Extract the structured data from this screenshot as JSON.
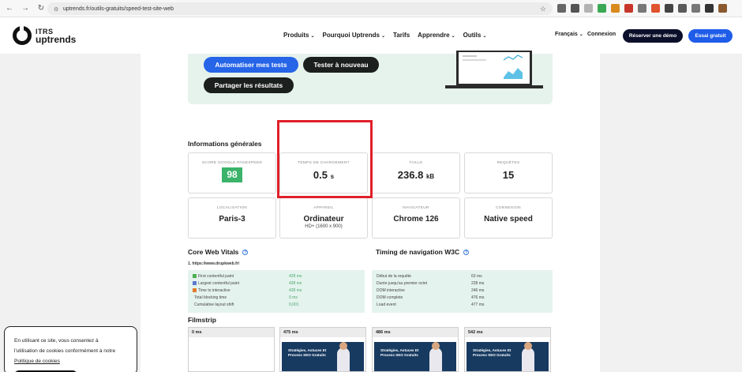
{
  "browser": {
    "url": "uptrends.fr/outils-gratuits/speed-test-site-web",
    "back_glyph": "←",
    "forward_glyph": "→",
    "reload_glyph": "↻",
    "lock_glyph": "⚙",
    "star_glyph": "☆",
    "extension_colors": [
      "#666666",
      "#555555",
      "#b3b3b3",
      "#3aa855",
      "#d98a1d",
      "#c8362b",
      "#777777",
      "#e0532f",
      "#444444",
      "#5a5a5a",
      "#777777",
      "#333333",
      "#8a5a2e"
    ]
  },
  "header": {
    "logo_line1": "ITRS",
    "logo_line2": "uptrends",
    "nav": [
      "Produits",
      "Pourquoi Uptrends",
      "Tarifs",
      "Apprendre",
      "Outils"
    ],
    "nav_has_chevron": [
      true,
      true,
      false,
      true,
      true
    ],
    "chevron_glyph": "⌄",
    "language": "Français",
    "login": "Connexion",
    "demo_button": "Réserver une démo",
    "trial_button": "Essai gratuit"
  },
  "hero": {
    "automate_button": "Automatiser mes tests",
    "retest_button": "Tester à nouveau",
    "share_button": "Partager les résultats"
  },
  "general_info": {
    "title": "Informations générales",
    "cards": [
      {
        "label": "SCORE GOOGLE PAGESPEED",
        "value": "98"
      },
      {
        "label": "TEMPS DE CHARGEMENT",
        "value": "0.5",
        "unit": "s"
      },
      {
        "label": "TAILLE",
        "value": "236.8",
        "unit": "kB"
      },
      {
        "label": "REQUÊTES",
        "value": "15"
      },
      {
        "label": "LOCALISATION",
        "value": "Paris-3"
      },
      {
        "label": "APPAREIL",
        "value": "Ordinateur",
        "sub": "HD+ (1600 x 900)"
      },
      {
        "label": "NAVIGATEUR",
        "value": "Chrome 126"
      },
      {
        "label": "CONNEXION",
        "value": "Native speed"
      }
    ]
  },
  "core_web_vitals": {
    "title": "Core Web Vitals",
    "help_glyph": "?",
    "site_url": "1. https://www.drupkweb.fr/",
    "rows": [
      {
        "name": "First contentful paint",
        "value": "428 ms",
        "color": "#4caf50"
      },
      {
        "name": "Largest contentful paint",
        "value": "428 ms",
        "color": "#5b7ad0"
      },
      {
        "name": "Time to interactive",
        "value": "428 ms",
        "color": "#e07b2c"
      },
      {
        "name": "Total blocking time",
        "value": "0 ms",
        "color": ""
      },
      {
        "name": "Cumulative layout shift",
        "value": "0,001",
        "color": ""
      }
    ]
  },
  "w3c_timing": {
    "title": "Timing de navigation W3C",
    "help_glyph": "?",
    "rows": [
      {
        "name": "Début de la requête",
        "value": "63 ms"
      },
      {
        "name": "Durée jusqu'au premier octet",
        "value": "228 ms"
      },
      {
        "name": "DOM interactive",
        "value": "246 ms"
      },
      {
        "name": "DOM complete",
        "value": "476 ms"
      },
      {
        "name": "Load event",
        "value": "477 ms"
      }
    ]
  },
  "filmstrip": {
    "title": "Filmstrip",
    "frames": [
      {
        "time": "0 ms",
        "caption": ""
      },
      {
        "time": "475 ms",
        "caption": "Stratégies, Astuces Et Process SEO Gratuits"
      },
      {
        "time": "486 ms",
        "caption": "Stratégies, Astuces Et Process SEO Gratuits"
      },
      {
        "time": "542 ms",
        "caption": "Stratégies, Astuces Et Process SEO Gratuits"
      }
    ]
  },
  "cookie_banner": {
    "line1": "En utilisant ce site, vous consentez à",
    "line2": "l'utilisation de cookies conformément à notre",
    "link": "Politique de cookies"
  },
  "colors": {
    "primary_blue": "#2664e8",
    "dark_navy": "#0b0f2a",
    "score_green": "#3bb36b",
    "highlight_red": "#e0202a",
    "hero_bg": "#e6f3ec"
  }
}
